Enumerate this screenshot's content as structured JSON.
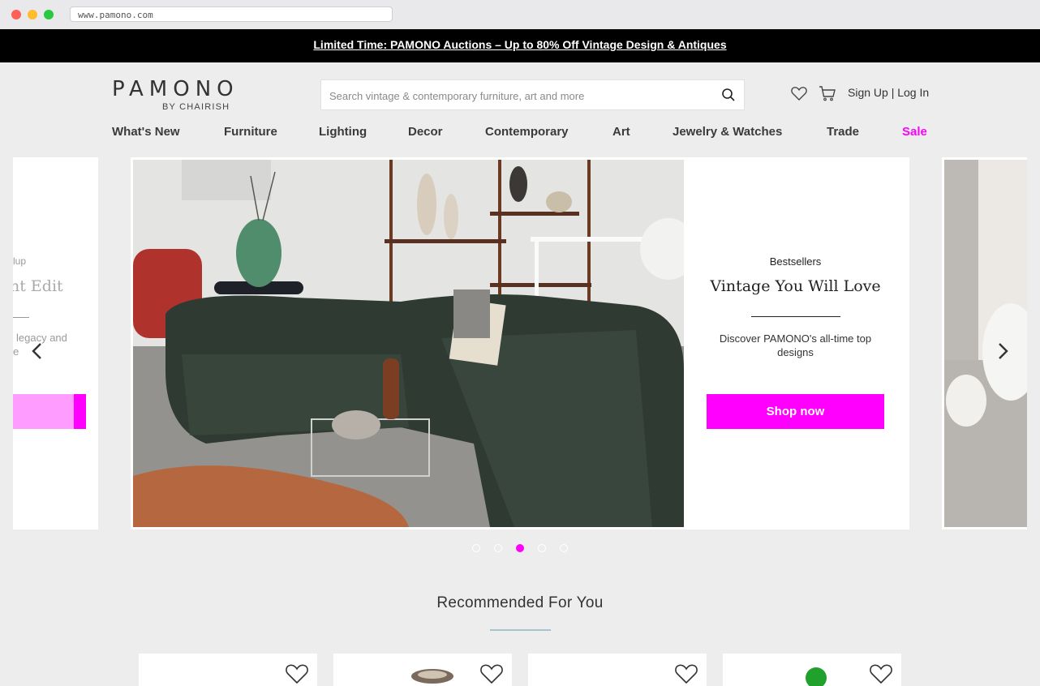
{
  "browser": {
    "url": "www.pamono.com"
  },
  "promo": {
    "text": "Limited Time: PAMONO Auctions – Up to 80% Off Vintage Design & Antiques"
  },
  "header": {
    "logo_text": "PAMONO",
    "logo_sub": "BY CHAIRISH",
    "search_placeholder": "Search vintage & contemporary furniture, art and more",
    "sign_up": "Sign Up",
    "separator": "|",
    "log_in": "Log In"
  },
  "nav": {
    "items": [
      "What's New",
      "Furniture",
      "Lighting",
      "Decor",
      "Contemporary",
      "Art",
      "Jewelry & Watches",
      "Trade",
      "Sale"
    ]
  },
  "carousel": {
    "prev_slide": {
      "eyebrow": "lup",
      "title": "nt Edit",
      "desc_1": "legacy and",
      "desc_2": "e"
    },
    "current": {
      "eyebrow": "Bestsellers",
      "title": "Vintage You Will Love",
      "description": "Discover PAMONO's all-time top designs",
      "button": "Shop now"
    },
    "active_index": 3,
    "total": 5
  },
  "recommended": {
    "title": "Recommended For You"
  },
  "colors": {
    "accent": "#ff00ff",
    "promo_bg": "#000000",
    "page_bg": "#ededed"
  }
}
